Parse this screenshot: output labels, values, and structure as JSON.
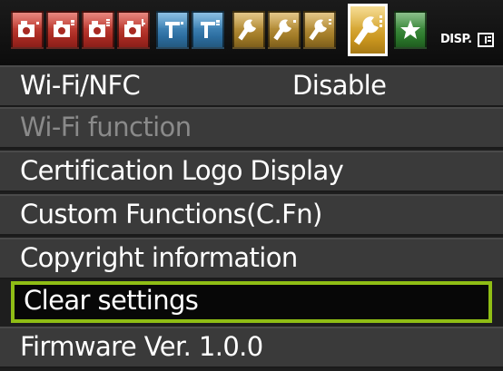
{
  "tabs": [
    {
      "name": "shooting-1",
      "group": "shooting",
      "icon": "camera-icon",
      "color": "#c0392b"
    },
    {
      "name": "shooting-2",
      "group": "shooting",
      "icon": "camera-icon",
      "color": "#c0392b"
    },
    {
      "name": "shooting-3",
      "group": "shooting",
      "icon": "camera-icon",
      "color": "#c0392b"
    },
    {
      "name": "shooting-4",
      "group": "shooting",
      "icon": "camera-icon",
      "color": "#c0392b"
    },
    {
      "name": "playback-1",
      "group": "playback",
      "icon": "play-icon",
      "color": "#2e86c1"
    },
    {
      "name": "playback-2",
      "group": "playback",
      "icon": "play-icon",
      "color": "#2e86c1"
    },
    {
      "name": "setup-1",
      "group": "setup",
      "icon": "wrench-icon",
      "color": "#b8860b"
    },
    {
      "name": "setup-2",
      "group": "setup",
      "icon": "wrench-icon",
      "color": "#b8860b"
    },
    {
      "name": "setup-3",
      "group": "setup",
      "icon": "wrench-icon",
      "color": "#d4a017",
      "active": true
    },
    {
      "name": "my-menu",
      "group": "my-menu",
      "icon": "star-icon",
      "color": "#2e8b2e"
    }
  ],
  "disp_label": "DISP.",
  "menu": {
    "items": [
      {
        "label": "Wi-Fi/NFC",
        "value": "Disable",
        "state": "normal"
      },
      {
        "label": "Wi-Fi function",
        "value": "",
        "state": "disabled"
      },
      {
        "label": "Certification Logo Display",
        "value": "",
        "state": "normal"
      },
      {
        "label": "Custom Functions(C.Fn)",
        "value": "",
        "state": "normal"
      },
      {
        "label": "Copyright information",
        "value": "",
        "state": "normal"
      },
      {
        "label": "Clear settings",
        "value": "",
        "state": "selected"
      },
      {
        "label": "Firmware Ver. 1.0.0",
        "value": "",
        "state": "normal"
      }
    ]
  },
  "colors": {
    "selection_border": "#8fbd15",
    "row_background": "#3a3a3a",
    "disabled_text": "#8a8a8a"
  }
}
